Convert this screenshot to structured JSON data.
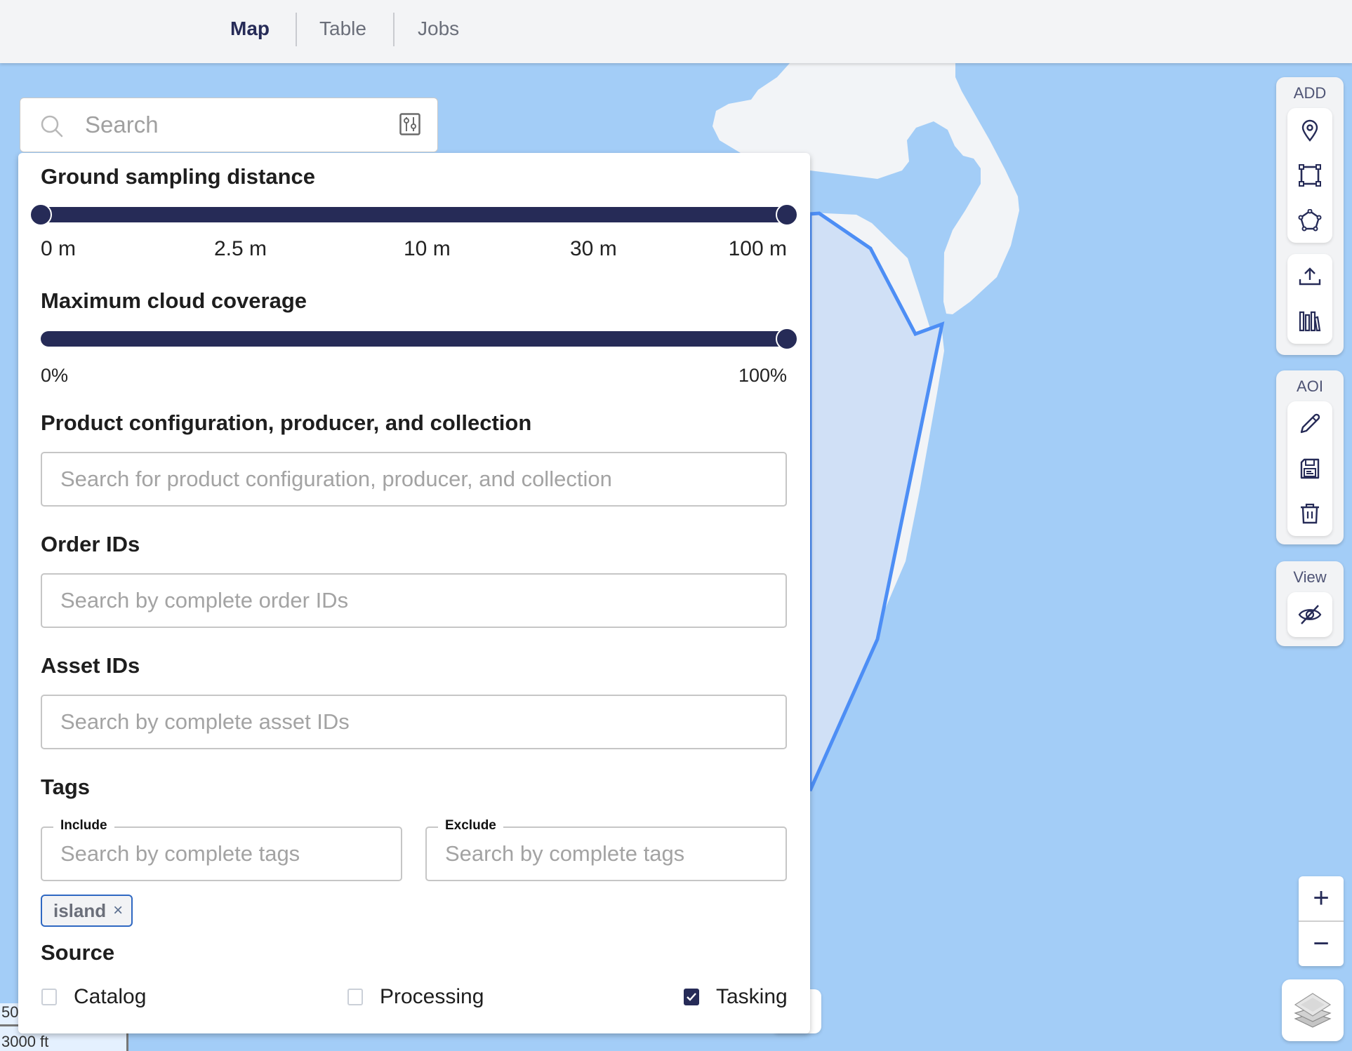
{
  "header": {
    "tabs": [
      {
        "label": "Map",
        "active": true
      },
      {
        "label": "Table",
        "active": false
      },
      {
        "label": "Jobs",
        "active": false
      }
    ]
  },
  "search": {
    "placeholder": "Search",
    "value": "",
    "search_icon": "search-icon",
    "filter_icon": "sliders-icon"
  },
  "filters": {
    "gsd": {
      "heading": "Ground sampling distance",
      "tick_labels": [
        "0 m",
        "2.5 m",
        "10 m",
        "30 m",
        "100 m"
      ],
      "range_min_fraction": 0.0,
      "range_max_fraction": 1.0,
      "selected_min": "0 m",
      "selected_max": "100 m"
    },
    "cloud": {
      "heading": "Maximum cloud coverage",
      "min_label": "0%",
      "max_label": "100%",
      "value_percent": 100
    },
    "product": {
      "heading": "Product configuration, producer, and collection",
      "placeholder": "Search for product configuration, producer, and collection",
      "value": ""
    },
    "order_ids": {
      "heading": "Order IDs",
      "placeholder": "Search by complete order IDs",
      "value": ""
    },
    "asset_ids": {
      "heading": "Asset IDs",
      "placeholder": "Search by complete asset IDs",
      "value": ""
    },
    "tags": {
      "heading": "Tags",
      "include_label": "Include",
      "include_placeholder": "Search by complete tags",
      "exclude_label": "Exclude",
      "exclude_placeholder": "Search by complete tags",
      "chips": [
        {
          "label": "island",
          "remove_glyph": "×"
        }
      ]
    },
    "source": {
      "heading": "Source",
      "options": [
        {
          "label": "Catalog",
          "checked": false
        },
        {
          "label": "Processing",
          "checked": false
        },
        {
          "label": "Tasking",
          "checked": true
        }
      ]
    }
  },
  "toolbar": {
    "add": {
      "label": "ADD",
      "tools": [
        "point-icon",
        "rectangle-icon",
        "polygon-icon",
        "upload-icon",
        "library-icon"
      ]
    },
    "aoi": {
      "label": "AOI",
      "tools": [
        "edit-icon",
        "save-icon",
        "delete-icon"
      ]
    },
    "view": {
      "label": "View",
      "tools": [
        "eye-off-icon"
      ]
    }
  },
  "zoom": {
    "in": "+",
    "out": "−"
  },
  "scale": {
    "top": "50",
    "bottom": "3000 ft"
  },
  "colors": {
    "accent": "#262b57",
    "water": "#a3cdf7",
    "land": "#f2f4f7",
    "aoi_stroke": "#4d8ef5",
    "aoi_fill": "#d0e0f6",
    "chip_border": "#2f68c2"
  }
}
